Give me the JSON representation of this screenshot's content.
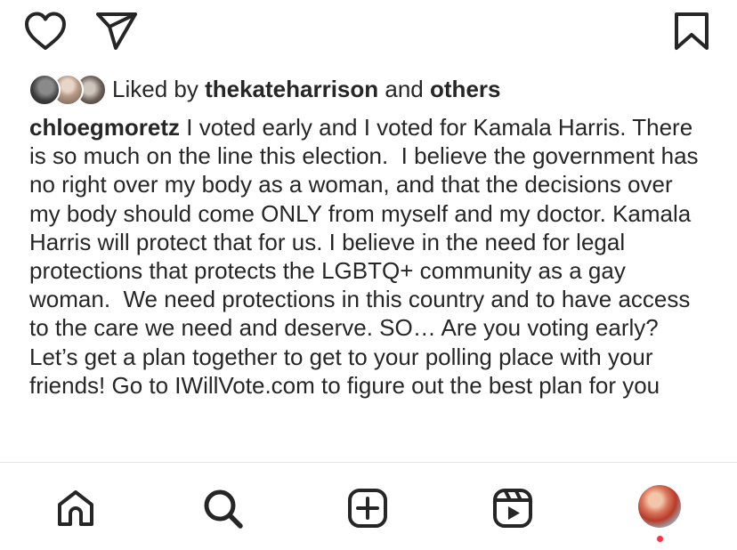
{
  "actions": {
    "like_icon": "heart-icon",
    "share_icon": "paper-plane-icon",
    "save_icon": "bookmark-icon"
  },
  "likes": {
    "prefix": "Liked by",
    "user": "thekateharrison",
    "connector": "and",
    "suffix": "others"
  },
  "caption": {
    "username": "chloegmoretz",
    "text": " I voted early and I voted for Kamala Harris. There is so much on the line this election.  I believe the government has no right over my body as a woman, and that the decisions over my body should come ONLY from myself and my doctor. Kamala Harris will protect that for us. I believe in the need for legal protections that protects the LGBTQ+ community as a gay woman.  We need protections in this country and to have access to the care we need and deserve. SO… Are you voting early? Let’s get a plan together to get to your polling place with your friends! Go to IWillVote.com to figure out the best plan for you"
  },
  "tab_bar": {
    "items": [
      {
        "icon": "home-icon"
      },
      {
        "icon": "search-icon"
      },
      {
        "icon": "create-post-icon"
      },
      {
        "icon": "reels-icon"
      },
      {
        "icon": "profile-avatar"
      }
    ]
  },
  "colors": {
    "text": "#262626",
    "notification_dot": "#ff3040",
    "divider": "#e6e6e6"
  }
}
